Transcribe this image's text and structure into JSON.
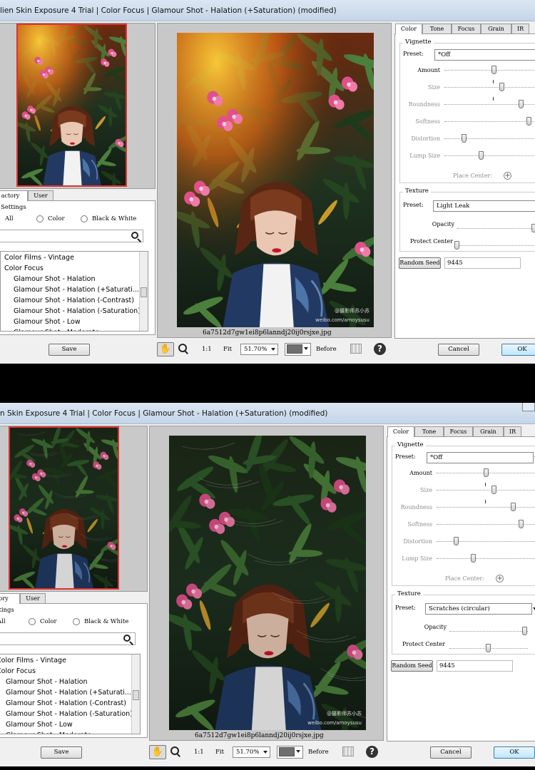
{
  "windows": [
    {
      "title": "lien Skin Exposure 4 Trial | Color Focus | Glamour Shot - Halation (+Saturation) (modified)",
      "left_tabs": [
        "actory",
        "User"
      ],
      "settings_label": "Settings",
      "filters": [
        "All",
        "Color",
        "Black & White"
      ],
      "selected_filter": "All",
      "list_items": [
        {
          "label": "Color Films - Vintage",
          "level": 0
        },
        {
          "label": "Color Focus",
          "level": 0
        },
        {
          "label": "Glamour Shot - Halation",
          "level": 1
        },
        {
          "label": "Glamour Shot - Halation (+Saturati...",
          "level": 1
        },
        {
          "label": "Glamour Shot - Halation (-Contrast)",
          "level": 1
        },
        {
          "label": "Glamour Shot - Halation (-Saturation)",
          "level": 1
        },
        {
          "label": "Glamour Shot - Low",
          "level": 1
        },
        {
          "label": "Glamour Shot - Moderate",
          "level": 1
        }
      ],
      "save_label": "Save",
      "file_name": "6a7512d7gw1ei8p6lanndj20ij0rsjxe.jpg",
      "zoom_1to1": "1:1",
      "zoom_fit": "Fit",
      "zoom_value": "51.70%",
      "before_label": "Before",
      "cancel_label": "Cancel",
      "ok_label": "OK",
      "right_tabs": [
        "Color",
        "Tone",
        "Focus",
        "Grain",
        "IR"
      ],
      "vignette": {
        "title": "Vignette",
        "preset_label": "Preset:",
        "preset_value": "*Off",
        "sliders": [
          {
            "label": "Amount",
            "value": 0.5,
            "enabled": true
          },
          {
            "label": "Size",
            "value": 0.58,
            "enabled": false
          },
          {
            "label": "Roundness",
            "value": 0.77,
            "enabled": false
          },
          {
            "label": "Softness",
            "value": 0.85,
            "enabled": false
          },
          {
            "label": "Distortion",
            "value": 0.2,
            "enabled": false
          },
          {
            "label": "Lump Size",
            "value": 0.37,
            "enabled": false
          }
        ],
        "place_center_label": "Place Center:"
      },
      "texture": {
        "title": "Texture",
        "preset_label": "Preset:",
        "preset_value": "Light Leak",
        "opacity_label": "Opacity",
        "opacity_value": 0.98,
        "protect_label": "Protect Center",
        "protect_value": 0.0
      },
      "random_seed_label": "Random Seed",
      "random_seed_value": "9445",
      "variant": "halation"
    },
    {
      "title": "n Skin Exposure 4 Trial | Color Focus | Glamour Shot - Halation (+Saturation) (modified)",
      "left_tabs": [
        "tory",
        "User"
      ],
      "settings_label": "ettings",
      "filters": [
        "All",
        "Color",
        "Black & White"
      ],
      "selected_filter": "All",
      "list_items": [
        {
          "label": "Color Films - Vintage",
          "level": 0
        },
        {
          "label": "Color Focus",
          "level": 0
        },
        {
          "label": "Glamour Shot - Halation",
          "level": 1
        },
        {
          "label": "Glamour Shot - Halation (+Saturati...",
          "level": 1
        },
        {
          "label": "Glamour Shot - Halation (-Contrast)",
          "level": 1
        },
        {
          "label": "Glamour Shot - Halation (-Saturation)",
          "level": 1
        },
        {
          "label": "Glamour Shot - Low",
          "level": 1
        },
        {
          "label": "Glamour Shot - Moderate",
          "level": 1
        }
      ],
      "save_label": "Save",
      "file_name": "6a7512d7gw1ei8p6lanndj20ij0rsjxe.jpg",
      "zoom_1to1": "1:1",
      "zoom_fit": "Fit",
      "zoom_value": "51.70%",
      "before_label": "Before",
      "cancel_label": "Cancel",
      "ok_label": "OK",
      "right_tabs": [
        "Color",
        "Tone",
        "Focus",
        "Grain",
        "IR"
      ],
      "vignette": {
        "title": "Vignette",
        "preset_label": "Preset:",
        "preset_value": "*Off",
        "sliders": [
          {
            "label": "Amount",
            "value": 0.5,
            "enabled": true
          },
          {
            "label": "Size",
            "value": 0.58,
            "enabled": false
          },
          {
            "label": "Roundness",
            "value": 0.77,
            "enabled": false
          },
          {
            "label": "Softness",
            "value": 0.85,
            "enabled": false
          },
          {
            "label": "Distortion",
            "value": 0.2,
            "enabled": false
          },
          {
            "label": "Lump Size",
            "value": 0.37,
            "enabled": false
          }
        ],
        "place_center_label": "Place Center:"
      },
      "texture": {
        "title": "Texture",
        "preset_label": "Preset:",
        "preset_value": "Scratches (circular)",
        "opacity_label": "Opacity",
        "opacity_value": 0.96,
        "protect_label": "Protect Center",
        "protect_value": 0.5
      },
      "random_seed_label": "Random Seed",
      "random_seed_value": "9445",
      "variant": "scratches"
    }
  ],
  "photo_watermark": [
    "@摄影师苏小苏",
    "weibo.com/amoysusu"
  ],
  "colors": {
    "title_bar": "#c9d8ea",
    "thumb_border": "#dd3333",
    "ok_button": "#bee6fd",
    "lips": "#c8142b",
    "flower_pink": "#e0508a"
  }
}
